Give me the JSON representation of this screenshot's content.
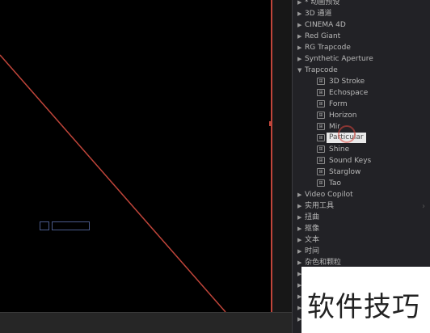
{
  "colors": {
    "guide_line": "#c0453a",
    "panel_bg": "#222226",
    "selected_bg": "#e9e9e9"
  },
  "effects_panel": {
    "items": [
      {
        "label": "* 动画预设",
        "kind": "category",
        "state": "collapsed"
      },
      {
        "label": "3D 通道",
        "kind": "category",
        "state": "collapsed"
      },
      {
        "label": "CINEMA 4D",
        "kind": "category",
        "state": "collapsed"
      },
      {
        "label": "Red Giant",
        "kind": "category",
        "state": "collapsed"
      },
      {
        "label": "RG Trapcode",
        "kind": "category",
        "state": "collapsed"
      },
      {
        "label": "Synthetic Aperture",
        "kind": "category",
        "state": "collapsed"
      },
      {
        "label": "Trapcode",
        "kind": "category",
        "state": "expanded"
      },
      {
        "label": "3D Stroke",
        "kind": "effect"
      },
      {
        "label": "Echospace",
        "kind": "effect"
      },
      {
        "label": "Form",
        "kind": "effect"
      },
      {
        "label": "Horizon",
        "kind": "effect"
      },
      {
        "label": "Mir",
        "kind": "effect"
      },
      {
        "label": "Particular",
        "kind": "effect",
        "selected": true
      },
      {
        "label": "Shine",
        "kind": "effect"
      },
      {
        "label": "Sound Keys",
        "kind": "effect"
      },
      {
        "label": "Starglow",
        "kind": "effect"
      },
      {
        "label": "Tao",
        "kind": "effect"
      },
      {
        "label": "Video Copilot",
        "kind": "category",
        "state": "collapsed"
      },
      {
        "label": "实用工具",
        "kind": "category",
        "state": "collapsed"
      },
      {
        "label": "扭曲",
        "kind": "category",
        "state": "collapsed"
      },
      {
        "label": "抠像",
        "kind": "category",
        "state": "collapsed"
      },
      {
        "label": "文本",
        "kind": "category",
        "state": "collapsed"
      },
      {
        "label": "时间",
        "kind": "category",
        "state": "collapsed"
      },
      {
        "label": "杂色和颗粒",
        "kind": "category",
        "state": "collapsed"
      },
      {
        "label": "",
        "kind": "category",
        "state": "collapsed"
      },
      {
        "label": "",
        "kind": "category",
        "state": "collapsed"
      },
      {
        "label": "",
        "kind": "category",
        "state": "collapsed"
      },
      {
        "label": "",
        "kind": "category",
        "state": "collapsed"
      },
      {
        "label": "",
        "kind": "category",
        "state": "collapsed"
      }
    ]
  },
  "watermark": {
    "text": "软件技巧"
  }
}
